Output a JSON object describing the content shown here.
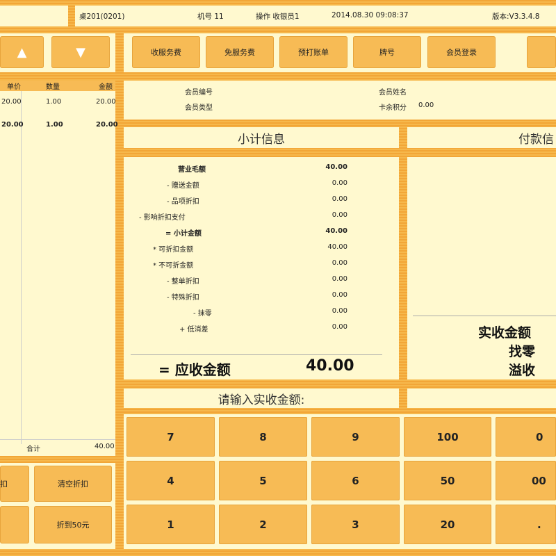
{
  "topbar": {
    "table": "桌201(0201)",
    "machine": "机号  11",
    "operator": "操作  收银员1",
    "datetime": "2014.08.30 09:08:37",
    "version": "版本:V3.3.4.8"
  },
  "nav": {
    "up": "▲",
    "down": "▼"
  },
  "actions": [
    "收服务费",
    "免服务费",
    "预打账单",
    "牌号",
    "会员登录"
  ],
  "order": {
    "headers": {
      "price": "单价",
      "qty": "数量",
      "amount": "金额"
    },
    "rows": [
      {
        "price": "20.00",
        "qty": "1.00",
        "amount": "20.00"
      },
      {
        "price": "20.00",
        "qty": "1.00",
        "amount": "20.00"
      }
    ],
    "total_label": "合计",
    "total_value": "40.00"
  },
  "member": {
    "id_label": "会员编号",
    "name_label": "会员姓名",
    "type_label": "会员类型",
    "points_label": "卡余积分",
    "points_value": "0.00"
  },
  "subtotal": {
    "title": "小计信息",
    "lines": [
      {
        "label": "营业毛额",
        "value": "40.00"
      },
      {
        "label": "- 赠送金额",
        "value": "0.00"
      },
      {
        "label": "- 品项折扣",
        "value": "0.00"
      },
      {
        "label": "- 影响折扣支付",
        "value": "0.00"
      },
      {
        "label": "= 小计金额",
        "value": "40.00"
      },
      {
        "label": "* 可折扣金额",
        "value": "40.00"
      },
      {
        "label": "* 不可折金额",
        "value": "0.00"
      },
      {
        "label": "- 整单折扣",
        "value": "0.00"
      },
      {
        "label": "- 特殊折扣",
        "value": "0.00"
      },
      {
        "label": "- 抹零",
        "value": "0.00"
      },
      {
        "label": "+ 低消差",
        "value": "0.00"
      }
    ],
    "due_label": "= 应收金额",
    "due_value": "40.00"
  },
  "payment": {
    "title": "付款信",
    "received": "实收金额",
    "change": "找零",
    "overpay": "溢收"
  },
  "prompt": "请输入实收金额:",
  "left_buttons": [
    "扣",
    "清空折扣",
    "折到50元"
  ],
  "keypad": [
    [
      "7",
      "8",
      "9",
      "100",
      "0"
    ],
    [
      "4",
      "5",
      "6",
      "50",
      "00"
    ],
    [
      "1",
      "2",
      "3",
      "20",
      "."
    ]
  ]
}
